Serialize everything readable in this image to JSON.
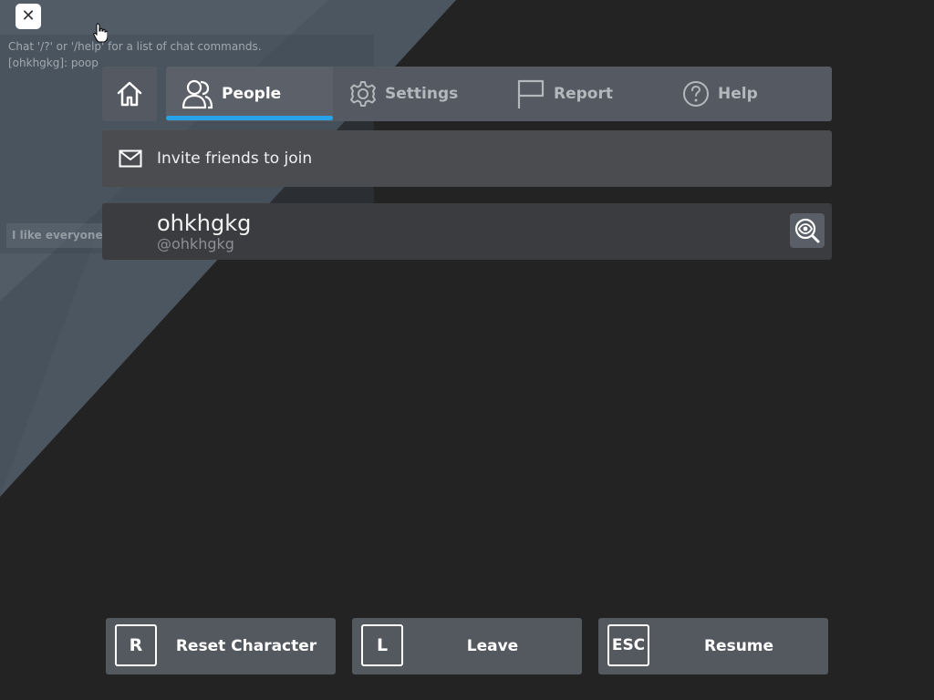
{
  "close": {
    "glyph": "✕"
  },
  "chat": {
    "lines": [
      "Chat '/?' or '/help' for a list of chat commands.",
      "[ohkhgkg]: poop"
    ],
    "input_text": "I like everyone in"
  },
  "nav": {
    "home_icon": "home-icon",
    "tabs": [
      {
        "label": "People",
        "icon": "people-icon",
        "active": true
      },
      {
        "label": "Settings",
        "icon": "gear-icon",
        "active": false
      },
      {
        "label": "Report",
        "icon": "flag-icon",
        "active": false
      },
      {
        "label": "Help",
        "icon": "help-icon",
        "active": false
      }
    ]
  },
  "invite": {
    "label": "Invite friends to join",
    "icon": "envelope-icon"
  },
  "players": [
    {
      "display_name": "ohkhgkg",
      "username": "@ohkhgkg",
      "action_icon": "inspect-icon"
    }
  ],
  "actions": [
    {
      "key": "R",
      "label": "Reset Character"
    },
    {
      "key": "L",
      "label": "Leave"
    },
    {
      "key": "ESC",
      "label": "Resume"
    }
  ],
  "colors": {
    "accent": "#28a3e8",
    "panel": "#545962",
    "background": "#232323"
  }
}
